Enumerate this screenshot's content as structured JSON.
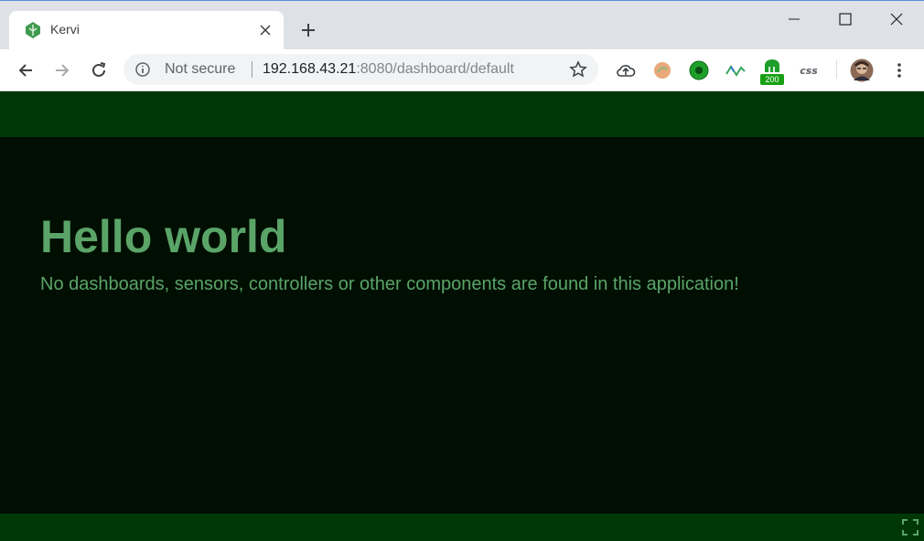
{
  "browser": {
    "tab": {
      "title": "Kervi",
      "favicon": "kervi-leaf-icon"
    },
    "address_bar": {
      "security_text": "Not secure",
      "url_host": "192.168.43.21",
      "url_rest": ":8080/dashboard/default"
    },
    "extensions": [
      {
        "name": "cloud-upload-icon"
      },
      {
        "name": "orange-extension-icon"
      },
      {
        "name": "green-circle-extension-icon"
      },
      {
        "name": "wave-extension-icon"
      },
      {
        "name": "counter-extension-icon",
        "badge": "200"
      },
      {
        "name": "css-extension-icon",
        "label": "css"
      }
    ]
  },
  "app": {
    "heading": "Hello world",
    "message": "No dashboards, sensors, controllers or other components are found in this application!",
    "colors": {
      "header": "#003707",
      "background": "#010f02",
      "text": "#5aa468"
    }
  }
}
